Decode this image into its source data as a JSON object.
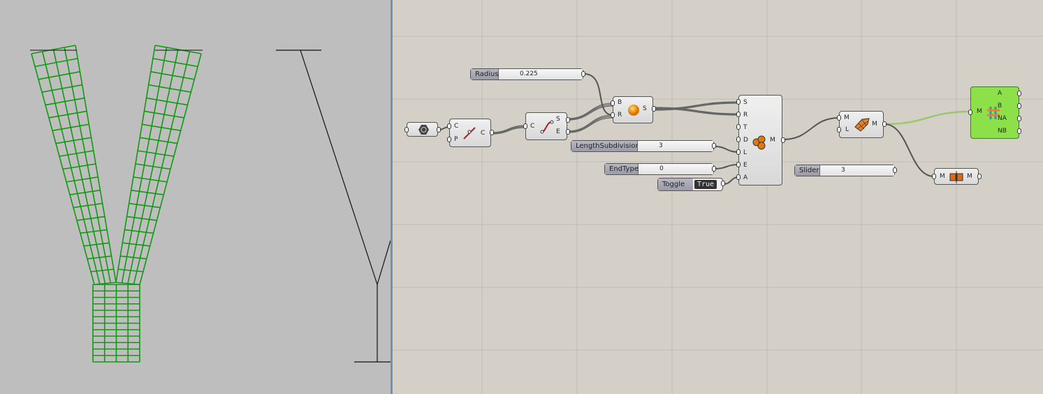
{
  "canvas": {
    "radius_slider": {
      "label": "Radius",
      "value": "0.225"
    },
    "length_slider": {
      "label": "LengthSubdivisions",
      "value": "3"
    },
    "endtype_slider": {
      "label": "EndType",
      "value": "0"
    },
    "toggle": {
      "label": "Toggle",
      "value": "True"
    },
    "slider": {
      "label": "Slider",
      "value": "3"
    },
    "curve_comp": {
      "inputs": [
        "C",
        "P"
      ],
      "output": "C"
    },
    "endpoints_comp": {
      "input": "C",
      "outputs": [
        "S",
        "E"
      ]
    },
    "sphere_comp": {
      "inputs": [
        "B",
        "R"
      ],
      "output": "S"
    },
    "main_comp": {
      "inputs": [
        "S",
        "R",
        "T",
        "D",
        "L",
        "E",
        "A"
      ],
      "output": "M"
    },
    "mesh_comp": {
      "inputs": [
        "M",
        "L"
      ],
      "output": "M"
    },
    "green_comp": {
      "input": "M",
      "outputs": [
        "A",
        "B",
        "NA",
        "NB"
      ]
    },
    "mirror_comp": {
      "input": "M",
      "output": "M"
    }
  },
  "colors": {
    "mesh": "#119911",
    "canvas": "#d4d0c8",
    "viewport": "#bebebe",
    "green_comp": "#8ee04a"
  }
}
